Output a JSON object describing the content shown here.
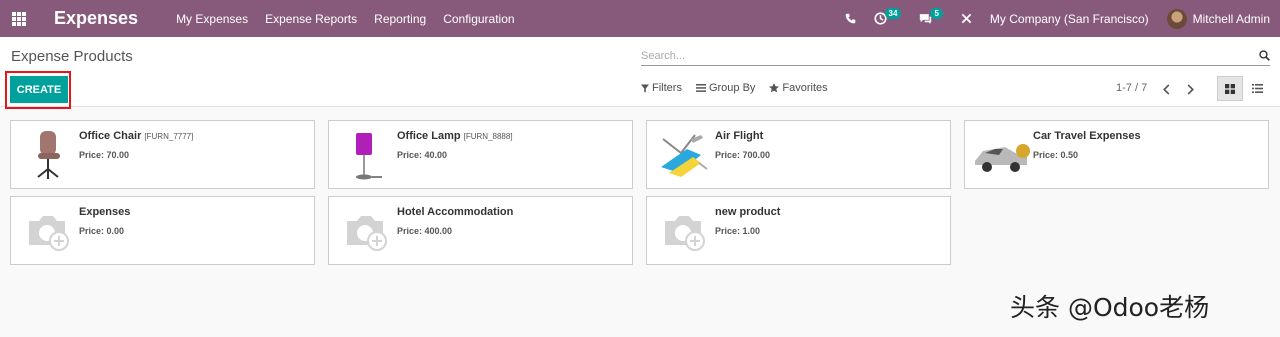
{
  "navbar": {
    "app_title": "Expenses",
    "menu": [
      "My Expenses",
      "Expense Reports",
      "Reporting",
      "Configuration"
    ],
    "activity_count": "34",
    "message_count": "5",
    "company": "My Company (San Francisco)",
    "user": "Mitchell Admin",
    "accent": "#875a7b"
  },
  "control_panel": {
    "breadcrumb": "Expense Products",
    "search_placeholder": "Search...",
    "create_label": "CREATE",
    "filters_label": "Filters",
    "groupby_label": "Group By",
    "favorites_label": "Favorites",
    "pager": "1-7 / 7"
  },
  "cards": [
    {
      "name": "Office Chair",
      "ref": "[FURN_7777]",
      "price": "Price: 70.00",
      "image": "office-chair"
    },
    {
      "name": "Office Lamp",
      "ref": "[FURN_8888]",
      "price": "Price: 40.00",
      "image": "office-lamp"
    },
    {
      "name": "Air Flight",
      "ref": "",
      "price": "Price: 700.00",
      "image": "air-flight"
    },
    {
      "name": "Car Travel Expenses",
      "ref": "",
      "price": "Price: 0.50",
      "image": "car"
    },
    {
      "name": "Expenses",
      "ref": "",
      "price": "Price: 0.00",
      "image": "placeholder"
    },
    {
      "name": "Hotel Accommodation",
      "ref": "",
      "price": "Price: 400.00",
      "image": "placeholder"
    },
    {
      "name": "new product",
      "ref": "",
      "price": "Price: 1.00",
      "image": "placeholder"
    }
  ],
  "watermark": "头条 @Odoo老杨"
}
